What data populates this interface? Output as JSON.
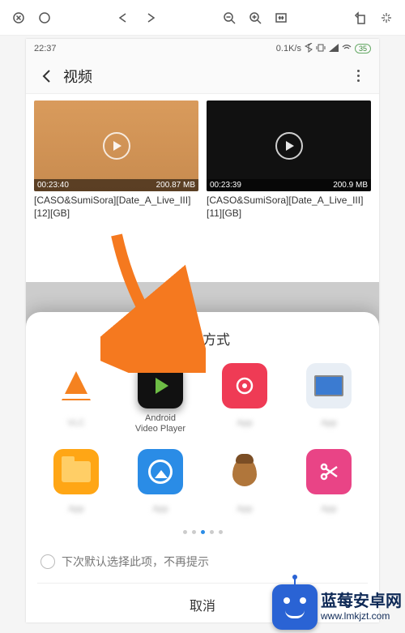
{
  "status": {
    "time": "22:37",
    "right": "0.1K/s",
    "battery": "35"
  },
  "appbar": {
    "title": "视频"
  },
  "videos": [
    {
      "duration": "00:23:40",
      "size": "200.87 MB",
      "title": "[CASO&SumiSora][Date_A_Live_III][12][GB]"
    },
    {
      "duration": "00:23:39",
      "size": "200.9 MB",
      "title": "[CASO&SumiSora][Date_A_Live_III][11][GB]"
    }
  ],
  "sheet": {
    "title": "打开方式",
    "checkbox_label": "下次默认选择此项，不再提示",
    "cancel": "取消"
  },
  "apps": [
    {
      "label": ""
    },
    {
      "label": "Android\nVideo Player"
    },
    {
      "label": ""
    },
    {
      "label": ""
    },
    {
      "label": ""
    },
    {
      "label": ""
    },
    {
      "label": ""
    },
    {
      "label": ""
    }
  ],
  "watermark": {
    "cn": "蓝莓安卓网",
    "url": "www.lmkjzt.com"
  }
}
